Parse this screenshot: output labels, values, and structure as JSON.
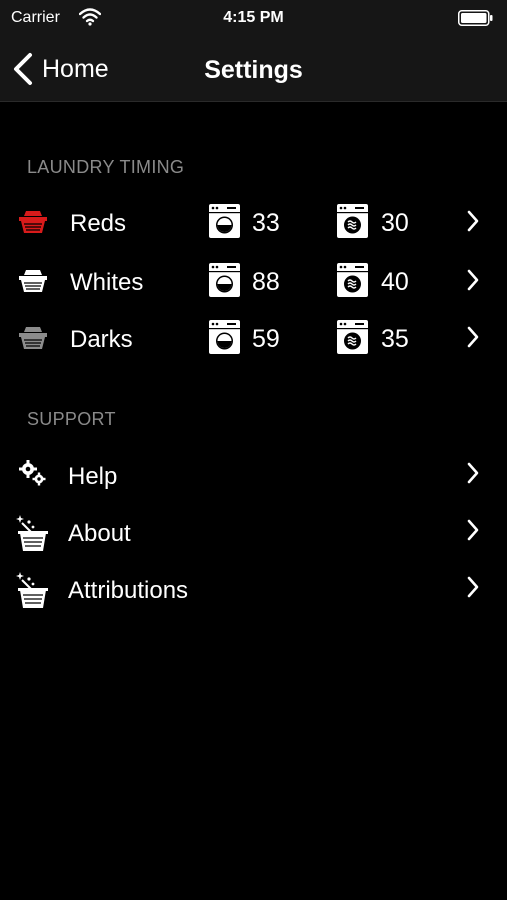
{
  "status_bar": {
    "carrier": "Carrier",
    "time": "4:15 PM"
  },
  "nav": {
    "back_label": "Home",
    "title": "Settings"
  },
  "laundry": {
    "header": "LAUNDRY TIMING",
    "rows": [
      {
        "label": "Reds",
        "wash": "33",
        "dry": "30",
        "color": "#d81b1b"
      },
      {
        "label": "Whites",
        "wash": "88",
        "dry": "40",
        "color": "#ffffff"
      },
      {
        "label": "Darks",
        "wash": "59",
        "dry": "35",
        "color": "#8c8c8c"
      }
    ]
  },
  "support": {
    "header": "SUPPORT",
    "items": [
      {
        "label": "Help",
        "icon": "gears-icon"
      },
      {
        "label": "About",
        "icon": "sparkle-basket-icon"
      },
      {
        "label": "Attributions",
        "icon": "sparkle-basket-icon"
      }
    ]
  }
}
